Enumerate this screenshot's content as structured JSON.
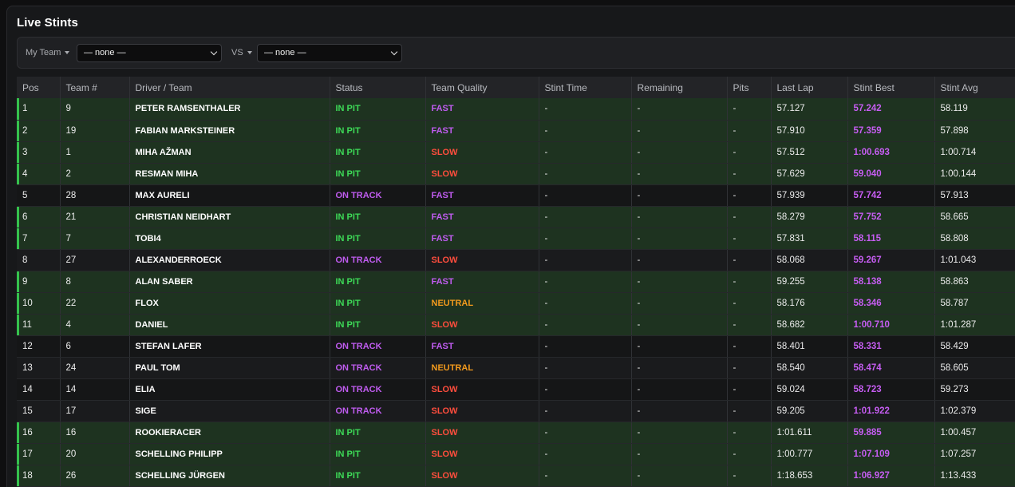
{
  "page": {
    "title": "Live Stints"
  },
  "toolbar": {
    "my_team_label": "My Team",
    "my_team_value": "— none —",
    "vs_label": "VS",
    "vs_value": "— none —"
  },
  "colors": {
    "in_pit": "#3ddb57",
    "on_track": "#c05cf0",
    "fast": "#c05cf0",
    "slow": "#ff4d3d",
    "neutral": "#f29a1d",
    "stint_best": "#c65df2"
  },
  "table": {
    "headers": [
      "Pos",
      "Team #",
      "Driver / Team",
      "Status",
      "Team Quality",
      "Stint Time",
      "Remaining",
      "Pits",
      "Last Lap",
      "Stint Best",
      "Stint Avg"
    ],
    "rows": [
      {
        "pos": "1",
        "team": "9",
        "driver": "PETER RAMSENTHALER",
        "status": "IN PIT",
        "quality": "FAST",
        "stint_time": "-",
        "remaining": "-",
        "pits": "-",
        "last_lap": "57.127",
        "stint_best": "57.242",
        "stint_avg": "58.119"
      },
      {
        "pos": "2",
        "team": "19",
        "driver": "FABIAN MARKSTEINER",
        "status": "IN PIT",
        "quality": "FAST",
        "stint_time": "-",
        "remaining": "-",
        "pits": "-",
        "last_lap": "57.910",
        "stint_best": "57.359",
        "stint_avg": "57.898"
      },
      {
        "pos": "3",
        "team": "1",
        "driver": "MIHA AŽMAN",
        "status": "IN PIT",
        "quality": "SLOW",
        "stint_time": "-",
        "remaining": "-",
        "pits": "-",
        "last_lap": "57.512",
        "stint_best": "1:00.693",
        "stint_avg": "1:00.714"
      },
      {
        "pos": "4",
        "team": "2",
        "driver": "RESMAN MIHA",
        "status": "IN PIT",
        "quality": "SLOW",
        "stint_time": "-",
        "remaining": "-",
        "pits": "-",
        "last_lap": "57.629",
        "stint_best": "59.040",
        "stint_avg": "1:00.144"
      },
      {
        "pos": "5",
        "team": "28",
        "driver": "MAX AURELI",
        "status": "ON TRACK",
        "quality": "FAST",
        "stint_time": "-",
        "remaining": "-",
        "pits": "-",
        "last_lap": "57.939",
        "stint_best": "57.742",
        "stint_avg": "57.913"
      },
      {
        "pos": "6",
        "team": "21",
        "driver": "CHRISTIAN NEIDHART",
        "status": "IN PIT",
        "quality": "FAST",
        "stint_time": "-",
        "remaining": "-",
        "pits": "-",
        "last_lap": "58.279",
        "stint_best": "57.752",
        "stint_avg": "58.665"
      },
      {
        "pos": "7",
        "team": "7",
        "driver": "TOBI4",
        "status": "IN PIT",
        "quality": "FAST",
        "stint_time": "-",
        "remaining": "-",
        "pits": "-",
        "last_lap": "57.831",
        "stint_best": "58.115",
        "stint_avg": "58.808"
      },
      {
        "pos": "8",
        "team": "27",
        "driver": "ALEXANDERROECK",
        "status": "ON TRACK",
        "quality": "SLOW",
        "stint_time": "-",
        "remaining": "-",
        "pits": "-",
        "last_lap": "58.068",
        "stint_best": "59.267",
        "stint_avg": "1:01.043"
      },
      {
        "pos": "9",
        "team": "8",
        "driver": "ALAN SABER",
        "status": "IN PIT",
        "quality": "FAST",
        "stint_time": "-",
        "remaining": "-",
        "pits": "-",
        "last_lap": "59.255",
        "stint_best": "58.138",
        "stint_avg": "58.863"
      },
      {
        "pos": "10",
        "team": "22",
        "driver": "FLOX",
        "status": "IN PIT",
        "quality": "NEUTRAL",
        "stint_time": "-",
        "remaining": "-",
        "pits": "-",
        "last_lap": "58.176",
        "stint_best": "58.346",
        "stint_avg": "58.787"
      },
      {
        "pos": "11",
        "team": "4",
        "driver": "DANIEL",
        "status": "IN PIT",
        "quality": "SLOW",
        "stint_time": "-",
        "remaining": "-",
        "pits": "-",
        "last_lap": "58.682",
        "stint_best": "1:00.710",
        "stint_avg": "1:01.287"
      },
      {
        "pos": "12",
        "team": "6",
        "driver": "STEFAN LAFER",
        "status": "ON TRACK",
        "quality": "FAST",
        "stint_time": "-",
        "remaining": "-",
        "pits": "-",
        "last_lap": "58.401",
        "stint_best": "58.331",
        "stint_avg": "58.429"
      },
      {
        "pos": "13",
        "team": "24",
        "driver": "PAUL TOM",
        "status": "ON TRACK",
        "quality": "NEUTRAL",
        "stint_time": "-",
        "remaining": "-",
        "pits": "-",
        "last_lap": "58.540",
        "stint_best": "58.474",
        "stint_avg": "58.605"
      },
      {
        "pos": "14",
        "team": "14",
        "driver": "ELIA",
        "status": "ON TRACK",
        "quality": "SLOW",
        "stint_time": "-",
        "remaining": "-",
        "pits": "-",
        "last_lap": "59.024",
        "stint_best": "58.723",
        "stint_avg": "59.273"
      },
      {
        "pos": "15",
        "team": "17",
        "driver": "SIGE",
        "status": "ON TRACK",
        "quality": "SLOW",
        "stint_time": "-",
        "remaining": "-",
        "pits": "-",
        "last_lap": "59.205",
        "stint_best": "1:01.922",
        "stint_avg": "1:02.379"
      },
      {
        "pos": "16",
        "team": "16",
        "driver": "ROOKIERACER",
        "status": "IN PIT",
        "quality": "SLOW",
        "stint_time": "-",
        "remaining": "-",
        "pits": "-",
        "last_lap": "1:01.611",
        "stint_best": "59.885",
        "stint_avg": "1:00.457"
      },
      {
        "pos": "17",
        "team": "20",
        "driver": "SCHELLING PHILIPP",
        "status": "IN PIT",
        "quality": "SLOW",
        "stint_time": "-",
        "remaining": "-",
        "pits": "-",
        "last_lap": "1:00.777",
        "stint_best": "1:07.109",
        "stint_avg": "1:07.257"
      },
      {
        "pos": "18",
        "team": "26",
        "driver": "SCHELLING JÜRGEN",
        "status": "IN PIT",
        "quality": "SLOW",
        "stint_time": "-",
        "remaining": "-",
        "pits": "-",
        "last_lap": "1:18.653",
        "stint_best": "1:06.927",
        "stint_avg": "1:13.433"
      }
    ]
  }
}
